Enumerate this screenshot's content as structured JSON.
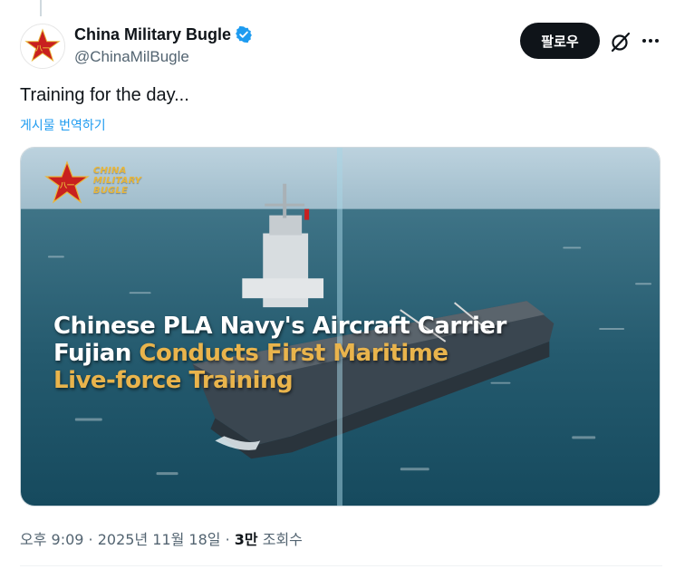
{
  "author": {
    "display_name": "China Military Bugle",
    "handle": "@ChinaMilBugle",
    "verified": true
  },
  "actions": {
    "follow_label": "팔로우",
    "grok_icon": "grok-icon",
    "more_icon": "more-icon"
  },
  "tweet": {
    "text": "Training for the day...",
    "translate_label": "게시물 번역하기"
  },
  "media": {
    "logo_lines": [
      "CHINA",
      "MILITARY",
      "BUGLE"
    ],
    "headline": {
      "white_1": "Chinese PLA Navy's Aircraft Carrier",
      "white_2": "Fujian ",
      "gold_1": "Conducts First Maritime",
      "gold_2": "Live-force Training"
    }
  },
  "meta": {
    "time": "오후 9:09",
    "separator": " · ",
    "date": "2025년 11월 18일",
    "views_count": "3만",
    "views_label": " 조회수"
  },
  "colors": {
    "accent": "#1d9bf0",
    "text": "#0f1419",
    "muted": "#536471",
    "headline_gold": "#e9b44c",
    "logo_red": "#c8201f"
  }
}
